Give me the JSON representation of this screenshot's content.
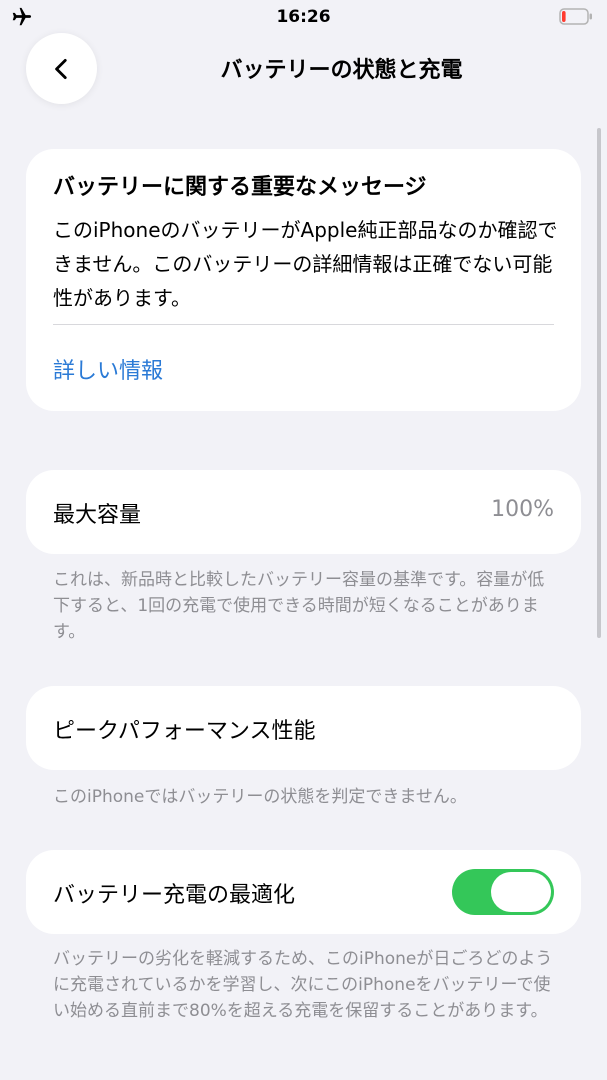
{
  "status_bar": {
    "time": "16:26",
    "airplane_icon": "airplane-icon",
    "battery_icon": "battery-low-icon",
    "battery_level": 0.15,
    "battery_color": "#ff3b30"
  },
  "nav": {
    "back_icon": "chevron-left-icon",
    "title": "バッテリーの状態と充電"
  },
  "important_message": {
    "title": "バッテリーに関する重要なメッセージ",
    "body": "このiPhoneのバッテリーがApple純正部品なのか確認できません。このバッテリーの詳細情報は正確でない可能性があります。",
    "link": "詳しい情報"
  },
  "max_capacity": {
    "label": "最大容量",
    "value": "100%",
    "footnote": "これは、新品時と比較したバッテリー容量の基準です。容量が低下すると、1回の充電で使用できる時間が短くなることがあります。"
  },
  "peak_performance": {
    "label": "ピークパフォーマンス性能",
    "footnote": "このiPhoneではバッテリーの状態を判定できません。"
  },
  "optimized_charging": {
    "label": "バッテリー充電の最適化",
    "enabled": true,
    "toggle_color": "#34c759",
    "footnote": "バッテリーの劣化を軽減するため、このiPhoneが日ごろどのように充電されているかを学習し、次にこのiPhoneをバッテリーで使い始める直前まで80%を超える充電を保留することがあります。"
  },
  "colors": {
    "background": "#f2f2f7",
    "link": "#2a7ad6",
    "secondary_text": "#8e8e93"
  }
}
